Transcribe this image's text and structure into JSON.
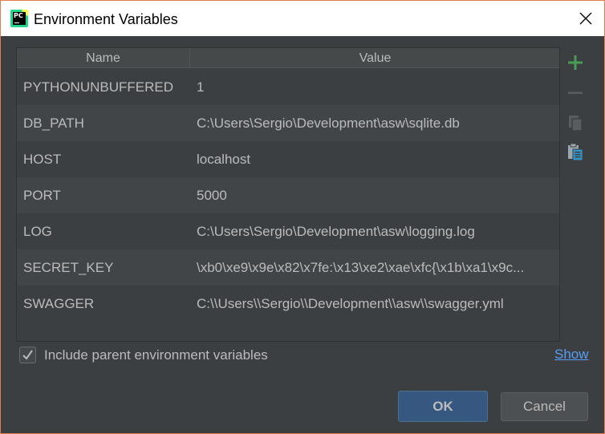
{
  "window": {
    "title": "Environment Variables",
    "app_icon_text": "PC",
    "border_color": "#e07b53"
  },
  "table": {
    "columns": [
      "Name",
      "Value"
    ],
    "rows": [
      {
        "name": "PYTHONUNBUFFERED",
        "value": "1"
      },
      {
        "name": "DB_PATH",
        "value": "C:\\Users\\Sergio\\Development\\asw\\sqlite.db"
      },
      {
        "name": "HOST",
        "value": "localhost"
      },
      {
        "name": "PORT",
        "value": "5000"
      },
      {
        "name": "LOG",
        "value": "C:\\Users\\Sergio\\Development\\asw\\logging.log"
      },
      {
        "name": "SECRET_KEY",
        "value": "\\xb0\\xe9\\x9e\\x82\\x7fe:\\x13\\xe2\\xae\\xfc{\\x1b\\xa1\\x9c..."
      },
      {
        "name": "SWAGGER",
        "value": "C:\\\\Users\\\\Sergio\\\\Development\\\\asw\\\\swagger.yml"
      }
    ]
  },
  "toolbar": {
    "add_icon": "plus-icon",
    "remove_icon": "minus-icon",
    "copy_icon": "copy-icon",
    "paste_icon": "paste-icon",
    "add_color": "#499c54",
    "remove_color": "#5a5d5f",
    "copy_color": "#5a5d5f",
    "paste_color": "#3592c4"
  },
  "include_parent": {
    "checked": true,
    "label": "Include parent environment variables"
  },
  "links": {
    "show": "Show"
  },
  "buttons": {
    "ok": "OK",
    "cancel": "Cancel"
  }
}
